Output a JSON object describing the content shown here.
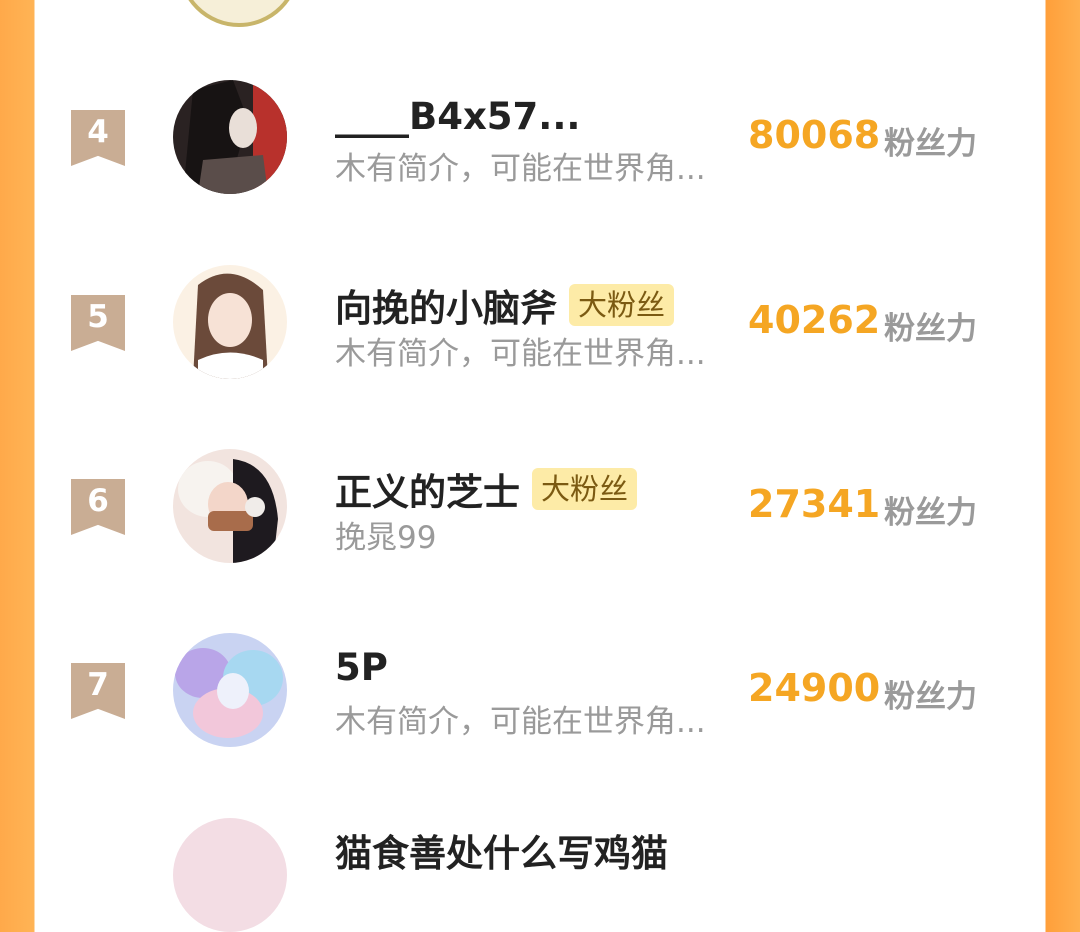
{
  "rows": [
    {
      "rank": "4",
      "name": "____B4x57...",
      "badge": "",
      "bio": "木有简介，可能在世界角...",
      "score": "80068",
      "unit": "粉丝力"
    },
    {
      "rank": "5",
      "name": "向挽的小脑斧",
      "badge": "大粉丝",
      "bio": "木有简介，可能在世界角...",
      "score": "40262",
      "unit": "粉丝力"
    },
    {
      "rank": "6",
      "name": "正义的芝士",
      "badge": "大粉丝",
      "bio": "挽晁99",
      "score": "27341",
      "unit": "粉丝力"
    },
    {
      "rank": "7",
      "name": "5P",
      "badge": "",
      "bio": "木有简介，可能在世界角...",
      "score": "24900",
      "unit": "粉丝力"
    }
  ],
  "partial_next_name": "猫食善处什么写鸡猫"
}
